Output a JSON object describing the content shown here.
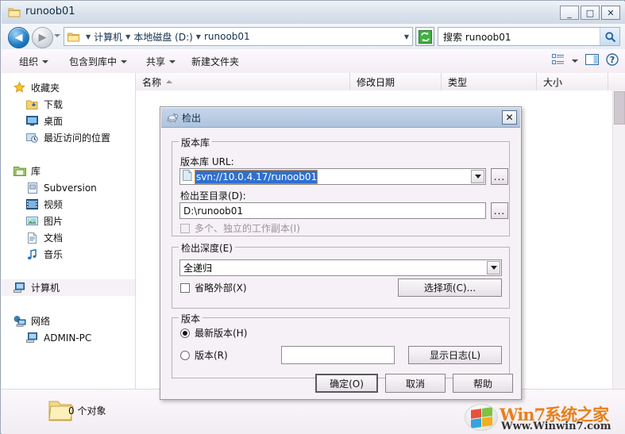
{
  "window": {
    "title": "runoob01",
    "icon": "folder-icon",
    "minimize_label": "_",
    "maximize_label": "□",
    "close_label": "✕"
  },
  "address_bar": {
    "back_label": "◀",
    "forward_label": "▶",
    "crumbs": [
      "计算机",
      "本地磁盘 (D:)",
      "runoob01"
    ],
    "refresh_icon": "refresh-icon",
    "search_placeholder": "搜索 runoob01",
    "search_icon": "search-icon"
  },
  "toolbar": {
    "items": [
      {
        "label": "组织",
        "caret": true
      },
      {
        "label": "包含到库中",
        "caret": true
      },
      {
        "label": "共享",
        "caret": true
      },
      {
        "label": "新建文件夹",
        "caret": false
      }
    ],
    "view_icon": "view-list-icon",
    "view_caret_icon": "chevron-down-icon",
    "pane_icon": "preview-pane-icon",
    "help_icon": "help-icon"
  },
  "sidebar": {
    "groups": [
      {
        "header": {
          "label": "收藏夹",
          "icon": "star-icon"
        },
        "items": [
          {
            "label": "下载",
            "icon": "downloads-icon"
          },
          {
            "label": "桌面",
            "icon": "desktop-icon"
          },
          {
            "label": "最近访问的位置",
            "icon": "recent-places-icon"
          }
        ]
      },
      {
        "header": {
          "label": "库",
          "icon": "library-icon"
        },
        "items": [
          {
            "label": "Subversion",
            "icon": "subversion-icon"
          },
          {
            "label": "视频",
            "icon": "video-icon"
          },
          {
            "label": "图片",
            "icon": "pictures-icon"
          },
          {
            "label": "文档",
            "icon": "documents-icon"
          },
          {
            "label": "音乐",
            "icon": "music-icon"
          }
        ]
      },
      {
        "header": {
          "label": "计算机",
          "icon": "computer-icon",
          "selected": true
        },
        "items": []
      },
      {
        "header": {
          "label": "网络",
          "icon": "network-icon"
        },
        "items": [
          {
            "label": "ADMIN-PC",
            "icon": "computer-icon"
          }
        ]
      }
    ]
  },
  "file_list": {
    "columns": [
      {
        "label": "名称",
        "sorted": true
      },
      {
        "label": "修改日期",
        "sorted": false
      },
      {
        "label": "类型",
        "sorted": false
      },
      {
        "label": "大小",
        "sorted": false
      }
    ],
    "rows": []
  },
  "status_bar": {
    "icon": "folder-icon",
    "text": "0 个对象"
  },
  "dialog": {
    "title": "检出",
    "icon": "tortoisesvn-icon",
    "close_label": "✕",
    "repository": {
      "group_label": "版本库",
      "url_label": "版本库 URL:",
      "url_value": "svn://10.0.4.17/runoob01",
      "url_browse_label": "...",
      "dir_label": "检出至目录(D):",
      "dir_value": "D:\\runoob01",
      "dir_browse_label": "...",
      "multiple_wc_label": "多个、独立的工作副本(I)",
      "multiple_wc_checked": false,
      "multiple_wc_disabled": true
    },
    "depth": {
      "group_label": "检出深度(E)",
      "value": "全递归",
      "omit_externals_label": "省略外部(X)",
      "omit_externals_checked": false,
      "choose_items_label": "选择项(C)..."
    },
    "revision": {
      "group_label": "版本",
      "head_label": "最新版本(H)",
      "head_selected": true,
      "rev_label": "版本(R)",
      "rev_selected": false,
      "rev_value": "",
      "show_log_label": "显示日志(L)"
    },
    "buttons": {
      "ok": "确定(O)",
      "cancel": "取消",
      "help": "帮助"
    }
  },
  "watermark": {
    "brand_en": "Win",
    "brand_num": "7",
    "brand_cn": "系统之家",
    "url": "Www.Winwin7.com"
  },
  "colors": {
    "dialog_bg": "#f6f1f6",
    "selection_blue": "#2f6fd0",
    "title_blue": "#aec3de",
    "accent_orange": "#e8801a",
    "accent_red": "#d22d2d"
  }
}
